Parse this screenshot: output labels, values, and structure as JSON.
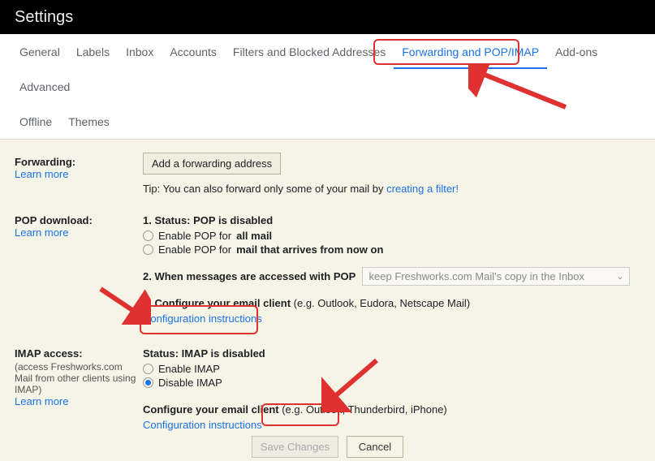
{
  "page_title": "Settings",
  "tabs": {
    "general": "General",
    "labels": "Labels",
    "inbox": "Inbox",
    "accounts": "Accounts",
    "filters": "Filters and Blocked Addresses",
    "forwarding": "Forwarding and POP/IMAP",
    "addons": "Add-ons",
    "advanced": "Advanced",
    "offline": "Offline",
    "themes": "Themes"
  },
  "forwarding": {
    "label": "Forwarding:",
    "learn_more": "Learn more",
    "add_btn": "Add a forwarding address",
    "tip_prefix": "Tip: You can also forward only some of your mail by ",
    "tip_link": "creating a filter!"
  },
  "pop": {
    "label": "POP download:",
    "learn_more": "Learn more",
    "status_prefix": "1. Status: ",
    "status_bold": "POP is disabled",
    "opt_prefix": "Enable POP for ",
    "opt_all": "all mail",
    "opt_new": "mail that arrives from now on",
    "accessed": "2. When messages are accessed with POP",
    "select_value": "keep Freshworks.com Mail's copy in the Inbox",
    "configure": "3. Configure your email client",
    "configure_hint": " (e.g. Outlook, Eudora, Netscape Mail)",
    "config_link": "Configuration instructions"
  },
  "imap": {
    "label": "IMAP access:",
    "sub": "(access Freshworks.com Mail from other clients using IMAP)",
    "learn_more": "Learn more",
    "status_prefix": "Status: ",
    "status_bold": "IMAP is disabled",
    "enable": "Enable IMAP",
    "disable": "Disable IMAP",
    "configure": "Configure your email client",
    "configure_hint": " (e.g. Outlook, Thunderbird, iPhone)",
    "config_link": "Configuration instructions"
  },
  "buttons": {
    "save": "Save Changes",
    "cancel": "Cancel"
  }
}
